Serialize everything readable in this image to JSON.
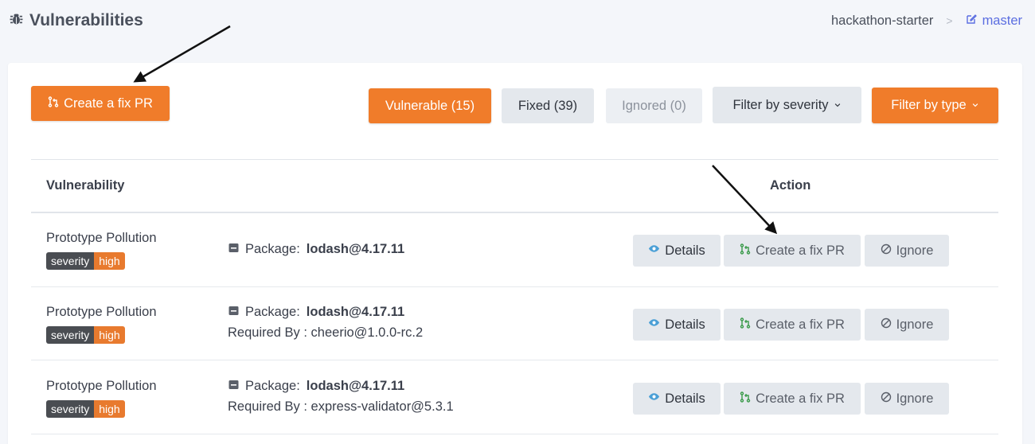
{
  "header": {
    "title": "Vulnerabilities",
    "repo": "hackathon-starter",
    "separator": ">",
    "branch": "master"
  },
  "toolbar": {
    "create_fix_pr": "Create a fix PR",
    "tabs": [
      {
        "label": "Vulnerable (15)",
        "state": "active"
      },
      {
        "label": "Fixed (39)",
        "state": "normal"
      },
      {
        "label": "Ignored (0)",
        "state": "muted"
      }
    ],
    "filter_severity": "Filter by severity",
    "filter_type": "Filter by type"
  },
  "table": {
    "columns": [
      "Vulnerability",
      "Action"
    ],
    "rows": [
      {
        "vulnerability": "Prototype Pollution",
        "severity_key": "severity",
        "severity_value": "high",
        "package_label": "Package:",
        "package": "lodash@4.17.11",
        "required_by": ""
      },
      {
        "vulnerability": "Prototype Pollution",
        "severity_key": "severity",
        "severity_value": "high",
        "package_label": "Package:",
        "package": "lodash@4.17.11",
        "required_by": "Required By : cheerio@1.0.0-rc.2"
      },
      {
        "vulnerability": "Prototype Pollution",
        "severity_key": "severity",
        "severity_value": "high",
        "package_label": "Package:",
        "package": "lodash@4.17.11",
        "required_by": "Required By : express-validator@5.3.1"
      }
    ],
    "actions": {
      "details": "Details",
      "create_fix_pr": "Create a fix PR",
      "ignore": "Ignore"
    }
  },
  "colors": {
    "accent_orange": "#f07c2a",
    "link_blue": "#5b6ee1",
    "severity_high": "#e87a2e",
    "icon_green": "#3a9a4a"
  }
}
